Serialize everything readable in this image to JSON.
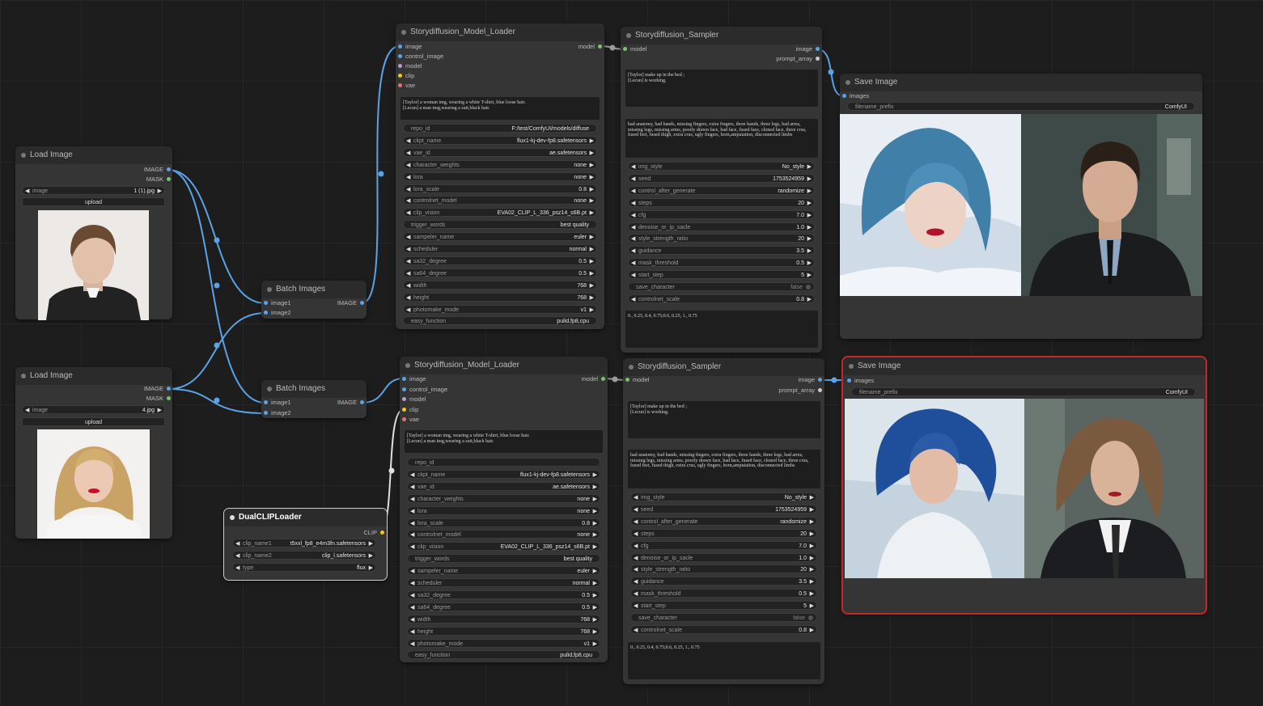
{
  "colors": {
    "image": "#5aa3e8",
    "mask": "#7ac26c",
    "model": "#b39ddb",
    "clip": "#f5c518",
    "vae": "#e57373",
    "link": "#5aa3e8",
    "link_white": "#e0e0e0",
    "selected": "#c62828"
  },
  "load_image_1": {
    "title": "Load Image",
    "out_image": "IMAGE",
    "out_mask": "MASK",
    "image_label": "image",
    "image_value": "1 (1).jpg",
    "upload": "upload"
  },
  "load_image_2": {
    "title": "Load Image",
    "out_image": "IMAGE",
    "out_mask": "MASK",
    "image_label": "image",
    "image_value": "4.jpg",
    "upload": "upload"
  },
  "batch_1": {
    "title": "Batch Images",
    "in1": "image1",
    "in2": "image2",
    "out": "IMAGE"
  },
  "batch_2": {
    "title": "Batch Images",
    "in1": "image1",
    "in2": "image2",
    "out": "IMAGE"
  },
  "dual_clip": {
    "title": "DualCLIPLoader",
    "out": "CLIP",
    "clip_name1_label": "clip_name1",
    "clip_name1": "t5xxl_fp8_e4m3fn.safetensors",
    "clip_name2_label": "clip_name2",
    "clip_name2": "clip_l.safetensors",
    "type_label": "type",
    "type": "flux"
  },
  "loader_1": {
    "title": "Storydiffusion_Model_Loader",
    "inputs": [
      "image",
      "control_image",
      "model",
      "clip",
      "vae"
    ],
    "out": "model",
    "prompt": "[Taylor] a woman img, wearing a white T-shirt, blue loose hair.\n[Lecun] a man img,wearing a suit,black hair.",
    "widgets": [
      {
        "label": "repo_id",
        "value": "F:/test/ComfyUI/models/diffuse"
      },
      {
        "label": "ckpt_name",
        "value": "flux1-kj-dev-fp8.safetensors"
      },
      {
        "label": "vae_id",
        "value": "ae.safetensors"
      },
      {
        "label": "character_weights",
        "value": "none"
      },
      {
        "label": "lora",
        "value": "none"
      },
      {
        "label": "lora_scale",
        "value": "0.8"
      },
      {
        "label": "controlnet_model",
        "value": "none"
      },
      {
        "label": "clip_vision",
        "value": "EVA02_CLIP_L_336_psz14_s6B.pt"
      },
      {
        "label": "trigger_words",
        "value": "best quality"
      },
      {
        "label": "sampeler_name",
        "value": "euler"
      },
      {
        "label": "scheduler",
        "value": "normal"
      },
      {
        "label": "sa32_degree",
        "value": "0.5"
      },
      {
        "label": "sa64_degree",
        "value": "0.5"
      },
      {
        "label": "width",
        "value": "768"
      },
      {
        "label": "height",
        "value": "768"
      },
      {
        "label": "photomake_mode",
        "value": "v1"
      },
      {
        "label": "easy_function",
        "value": "pulid,fp8,cpu"
      }
    ]
  },
  "loader_2": {
    "title": "Storydiffusion_Model_Loader",
    "inputs": [
      "image",
      "control_image",
      "model",
      "clip",
      "vae"
    ],
    "out": "model",
    "prompt": "[Taylor] a woman img, wearing a white T-shirt, blue loose hair.\n[Lecun] a man img,wearing a suit,black hair.",
    "widgets": [
      {
        "label": "repo_id",
        "value": ""
      },
      {
        "label": "ckpt_name",
        "value": "flux1-kj-dev-fp8.safetensors"
      },
      {
        "label": "vae_id",
        "value": "ae.safetensors"
      },
      {
        "label": "character_weights",
        "value": "none"
      },
      {
        "label": "lora",
        "value": "none"
      },
      {
        "label": "lora_scale",
        "value": "0.8"
      },
      {
        "label": "controlnet_model",
        "value": "none"
      },
      {
        "label": "clip_vision",
        "value": "EVA02_CLIP_L_336_psz14_s6B.pt"
      },
      {
        "label": "trigger_words",
        "value": "best quality"
      },
      {
        "label": "sampeler_name",
        "value": "euler"
      },
      {
        "label": "scheduler",
        "value": "normal"
      },
      {
        "label": "sa32_degree",
        "value": "0.5"
      },
      {
        "label": "sa64_degree",
        "value": "0.5"
      },
      {
        "label": "width",
        "value": "768"
      },
      {
        "label": "height",
        "value": "768"
      },
      {
        "label": "photomake_mode",
        "value": "v1"
      },
      {
        "label": "easy_function",
        "value": "pulid,fp8,cpu"
      }
    ]
  },
  "sampler_1": {
    "title": "Storydiffusion_Sampler",
    "in": "model",
    "out_image": "image",
    "out_prompt": "prompt_array",
    "prompt": "[Taylor] make up in the bed ;\n[Lecun] is working.",
    "negative": "bad anatomy, bad hands, missing fingers, extra fingers, three hands, three legs, bad arms, missing legs, missing arms, poorly drawn face, bad face, fused face, cloned face, three crus, fused feet, fused thigh, extra crus, ugly fingers, horn,amputation, disconnected limbs",
    "widgets": [
      {
        "label": "img_style",
        "value": "No_style"
      },
      {
        "label": "seed",
        "value": "1753524959"
      },
      {
        "label": "control_after_generate",
        "value": "randomize"
      },
      {
        "label": "steps",
        "value": "20"
      },
      {
        "label": "cfg",
        "value": "7.0"
      },
      {
        "label": "denoise_or_ip_sacle",
        "value": "1.0"
      },
      {
        "label": "style_strength_ratio",
        "value": "20"
      },
      {
        "label": "guidance",
        "value": "3.5"
      },
      {
        "label": "mask_threshold",
        "value": "0.5"
      },
      {
        "label": "start_step",
        "value": "5"
      },
      {
        "label": "save_character",
        "value": "false"
      },
      {
        "label": "controlnet_scale",
        "value": "0.8"
      }
    ],
    "bottom": "0., 0.25, 0.4, 0.75;0.6, 0.25, 1., 0.75"
  },
  "sampler_2": {
    "title": "Storydiffusion_Sampler",
    "in": "model",
    "out_image": "image",
    "out_prompt": "prompt_array",
    "prompt": "[Taylor] make up in the bed ;\n[Lecun] is working.",
    "negative": "bad anatomy, bad hands, missing fingers, extra fingers, three hands, three legs, bad arms, missing legs, missing arms, poorly drawn face, bad face, fused face, cloned face, three crus, fused feet, fused thigh, extra crus, ugly fingers, horn,amputation, disconnected limbs",
    "widgets": [
      {
        "label": "img_style",
        "value": "No_style"
      },
      {
        "label": "seed",
        "value": "1753524959"
      },
      {
        "label": "control_after_generate",
        "value": "randomize"
      },
      {
        "label": "steps",
        "value": "20"
      },
      {
        "label": "cfg",
        "value": "7.0"
      },
      {
        "label": "denoise_or_ip_sacle",
        "value": "1.0"
      },
      {
        "label": "style_strength_ratio",
        "value": "20"
      },
      {
        "label": "guidance",
        "value": "3.5"
      },
      {
        "label": "mask_threshold",
        "value": "0.5"
      },
      {
        "label": "start_step",
        "value": "5"
      },
      {
        "label": "save_character",
        "value": "false"
      },
      {
        "label": "controlnet_scale",
        "value": "0.8"
      }
    ],
    "bottom": "0., 0.25, 0.4, 0.75;0.6, 0.25, 1., 0.75"
  },
  "save_1": {
    "title": "Save Image",
    "in": "images",
    "prefix_label": "filename_prefix",
    "prefix_value": "ComfyUI"
  },
  "save_2": {
    "title": "Save Image",
    "in": "images",
    "prefix_label": "filename_prefix",
    "prefix_value": "ComfyUI"
  }
}
